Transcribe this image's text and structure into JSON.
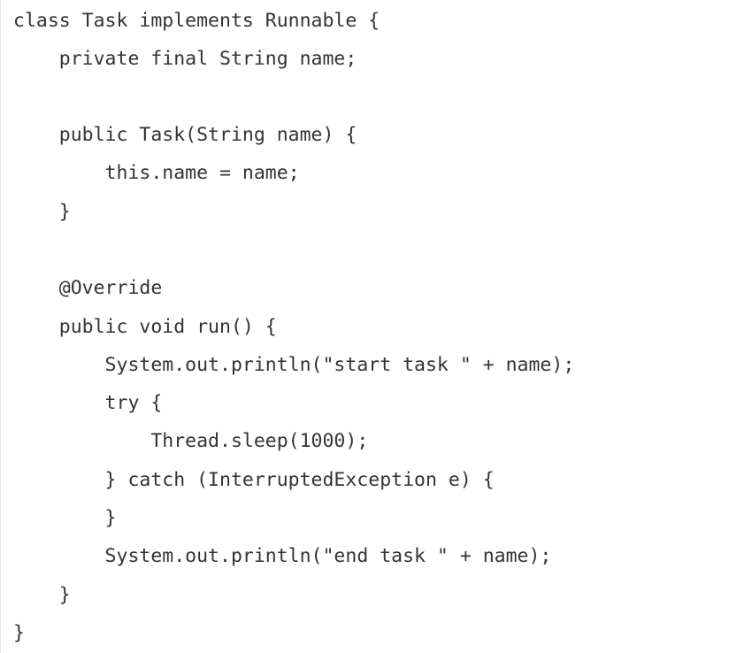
{
  "code": {
    "language": "java",
    "lines": [
      "class Task implements Runnable {",
      "    private final String name;",
      "",
      "    public Task(String name) {",
      "        this.name = name;",
      "    }",
      "",
      "    @Override",
      "    public void run() {",
      "        System.out.println(\"start task \" + name);",
      "        try {",
      "            Thread.sleep(1000);",
      "        } catch (InterruptedException e) {",
      "        }",
      "        System.out.println(\"end task \" + name);",
      "    }",
      "}"
    ]
  }
}
